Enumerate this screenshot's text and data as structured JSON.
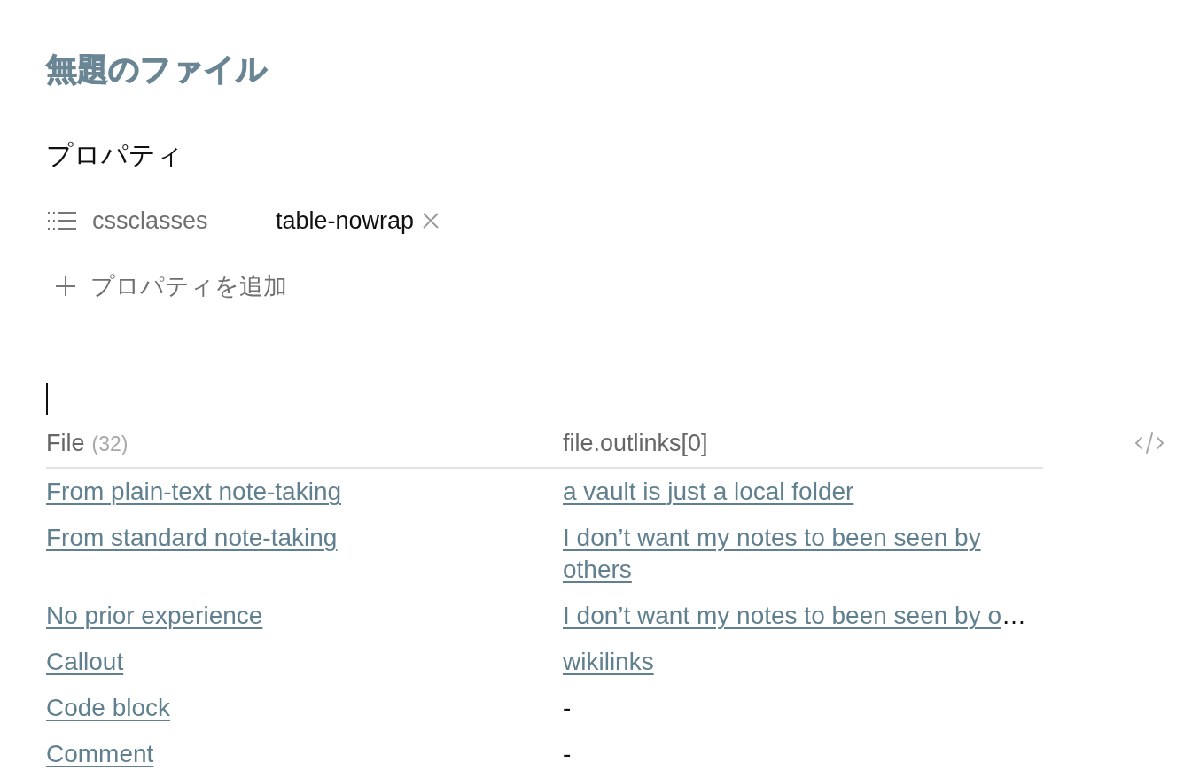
{
  "note": {
    "title": "無題のファイル"
  },
  "properties": {
    "heading": "プロパティ",
    "items": [
      {
        "kind": "list",
        "key": "cssclasses",
        "values": [
          "table-nowrap"
        ]
      }
    ],
    "add_button": {
      "label": "プロパティを追加"
    }
  },
  "editor": {
    "caret": true
  },
  "table": {
    "columns": [
      {
        "label": "File",
        "count": "(32)"
      },
      {
        "label": "file.outlinks[0]"
      }
    ],
    "rows": [
      {
        "cells": [
          {
            "kind": "link",
            "text": "From plain-text note-taking",
            "truncated": false
          },
          {
            "kind": "link",
            "text": "a vault is just a local folder",
            "truncated": false
          }
        ]
      },
      {
        "cells": [
          {
            "kind": "link",
            "text": "From standard note-taking",
            "truncated": false
          },
          {
            "kind": "link",
            "text": "I don’t want my notes to been seen by others",
            "truncated": false
          }
        ]
      },
      {
        "cells": [
          {
            "kind": "link",
            "text": "No prior experience",
            "truncated": false
          },
          {
            "kind": "link",
            "text": "I don’t want my notes to been seen by o…",
            "truncated": true
          }
        ]
      },
      {
        "cells": [
          {
            "kind": "link",
            "text": "Callout",
            "truncated": false
          },
          {
            "kind": "link",
            "text": "wikilinks",
            "truncated": false
          }
        ]
      },
      {
        "cells": [
          {
            "kind": "link",
            "text": "Code block",
            "truncated": false
          },
          {
            "kind": "plain",
            "text": "-"
          }
        ]
      },
      {
        "cells": [
          {
            "kind": "link",
            "text": "Comment",
            "truncated": false
          },
          {
            "kind": "plain",
            "text": "-"
          }
        ]
      }
    ]
  }
}
